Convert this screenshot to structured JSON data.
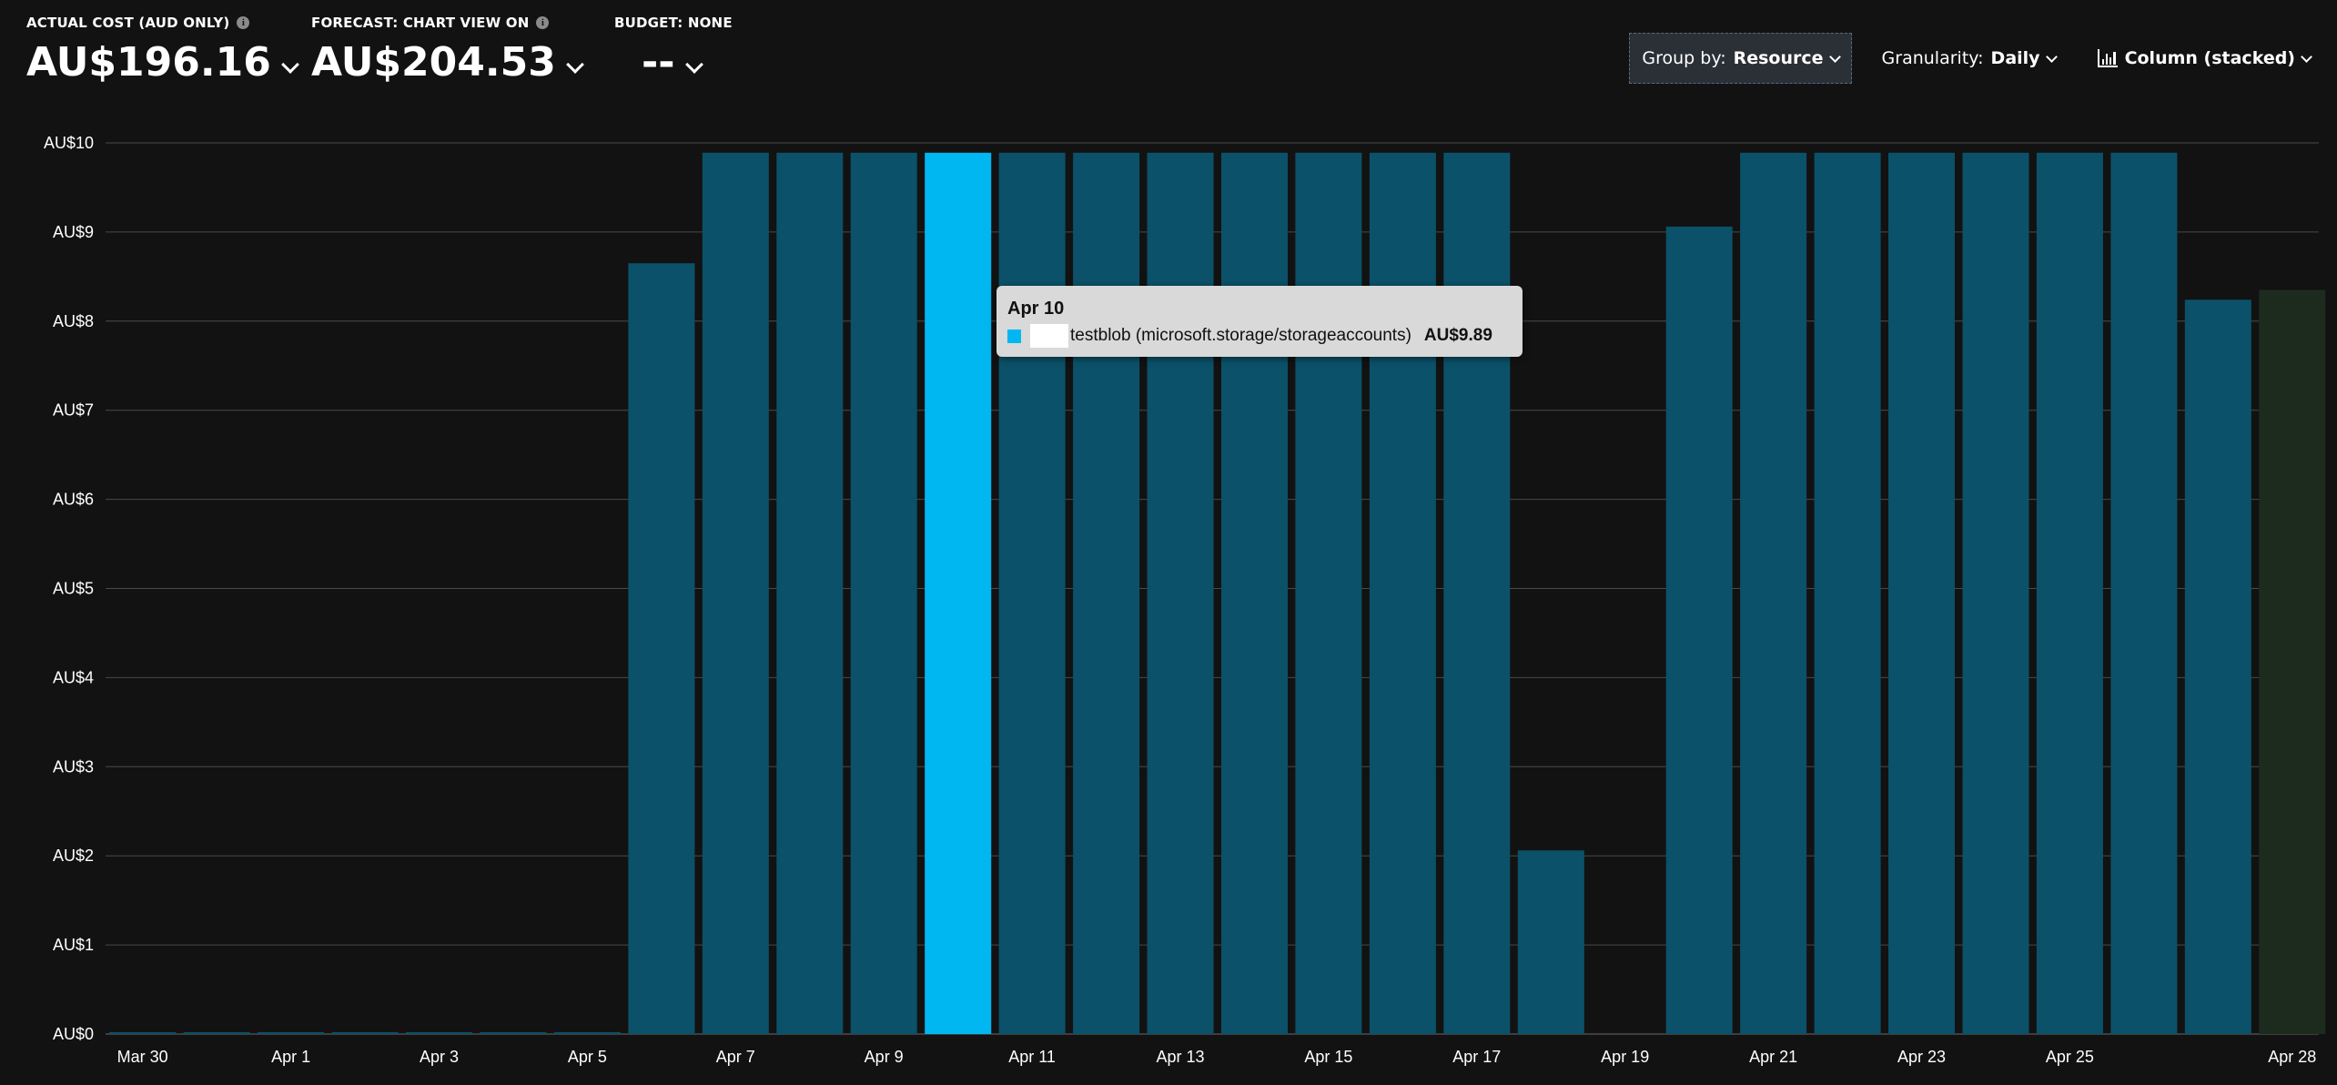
{
  "header": {
    "actual_cost": {
      "label": "ACTUAL COST (AUD ONLY)",
      "value": "AU$196.16"
    },
    "forecast": {
      "label": "FORECAST: CHART VIEW ON",
      "value": "AU$204.53"
    },
    "budget": {
      "label": "BUDGET: NONE",
      "value": "--"
    }
  },
  "controls": {
    "group_by": {
      "prefix": "Group by:",
      "value": "Resource"
    },
    "granularity": {
      "prefix": "Granularity:",
      "value": "Daily"
    },
    "chart_type": {
      "value": "Column (stacked)"
    }
  },
  "colors": {
    "bar": "#0b5169",
    "bar_highlight": "#00b7f1",
    "forecast_bar": "#1c2b1e",
    "grid": "#4a4a4a",
    "background": "#121212"
  },
  "tooltip": {
    "date": "Apr 10",
    "resource": "testblob (microsoft.storage/storageaccounts)",
    "value": "AU$9.89"
  },
  "chart_data": {
    "type": "bar",
    "stacked": true,
    "categories": [
      "Mar 30",
      "Mar 31",
      "Apr 1",
      "Apr 2",
      "Apr 3",
      "Apr 4",
      "Apr 5",
      "Apr 6",
      "Apr 7",
      "Apr 8",
      "Apr 9",
      "Apr 10",
      "Apr 11",
      "Apr 12",
      "Apr 13",
      "Apr 14",
      "Apr 15",
      "Apr 16",
      "Apr 17",
      "Apr 18",
      "Apr 19",
      "Apr 20",
      "Apr 21",
      "Apr 22",
      "Apr 23",
      "Apr 24",
      "Apr 25",
      "Apr 26",
      "Apr 27",
      "Apr 28"
    ],
    "x_tick_labels": [
      "Mar 30",
      "Apr 1",
      "Apr 3",
      "Apr 5",
      "Apr 7",
      "Apr 9",
      "Apr 11",
      "Apr 13",
      "Apr 15",
      "Apr 17",
      "Apr 19",
      "Apr 21",
      "Apr 23",
      "Apr 25",
      "Apr 28"
    ],
    "x_tick_indices": [
      0,
      2,
      4,
      6,
      8,
      10,
      12,
      14,
      16,
      18,
      20,
      22,
      24,
      26,
      29
    ],
    "y_tick_labels": [
      "AU$0",
      "AU$1",
      "AU$2",
      "AU$3",
      "AU$4",
      "AU$5",
      "AU$6",
      "AU$7",
      "AU$8",
      "AU$9",
      "AU$10"
    ],
    "ylim": [
      0,
      10
    ],
    "series": [
      {
        "name": "testblob (microsoft.storage/storageaccounts)",
        "values": [
          0.02,
          0.02,
          0.02,
          0.02,
          0.02,
          0.02,
          0.02,
          8.65,
          9.89,
          9.89,
          9.89,
          9.89,
          9.89,
          9.89,
          9.89,
          9.89,
          9.89,
          9.89,
          9.89,
          2.06,
          0,
          9.06,
          9.89,
          9.89,
          9.89,
          9.89,
          9.89,
          9.89,
          8.24,
          0
        ]
      }
    ],
    "forecast": {
      "index": 29,
      "value": 8.35
    },
    "highlight_index": 11,
    "grid": true
  }
}
